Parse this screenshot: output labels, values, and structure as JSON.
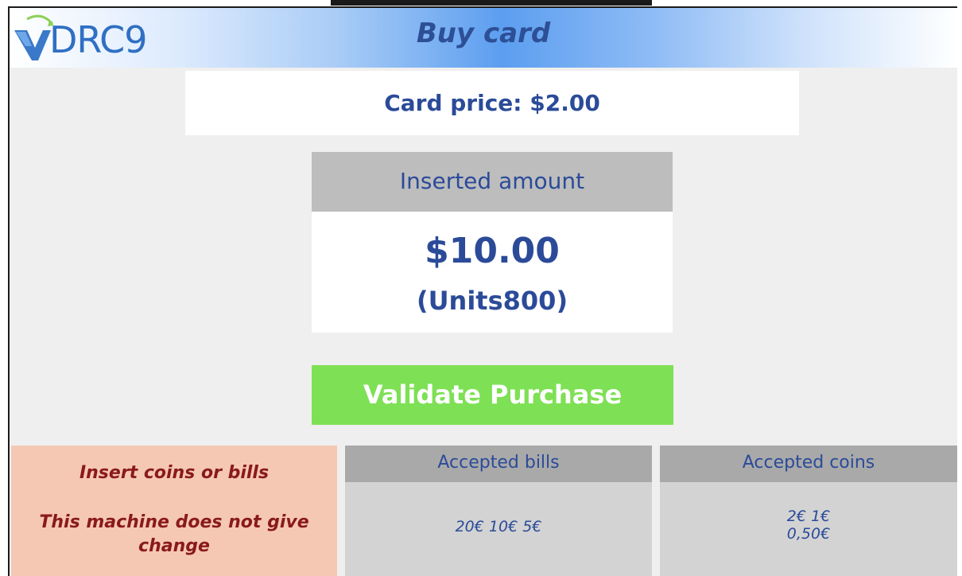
{
  "header": {
    "logo_text": "DRC9",
    "title": "Buy card"
  },
  "price": {
    "label": "Card price: $2.00"
  },
  "inserted": {
    "heading": "Inserted amount",
    "amount": "$10.00",
    "units": "(Units800)"
  },
  "actions": {
    "validate_label": "Validate Purchase"
  },
  "notice": {
    "line1": "Insert coins or bills",
    "line2": "This machine does not give change"
  },
  "bills": {
    "heading": "Accepted bills",
    "values": "20€ 10€ 5€"
  },
  "coins": {
    "heading": "Accepted coins",
    "line1": "2€ 1€",
    "line2": "0,50€"
  },
  "colors": {
    "title": "#2d4f96",
    "text_blue": "#2b4b99",
    "validate_green": "#7ee055",
    "notice_bg": "#f5c8b3",
    "notice_text": "#8a1a1a"
  }
}
